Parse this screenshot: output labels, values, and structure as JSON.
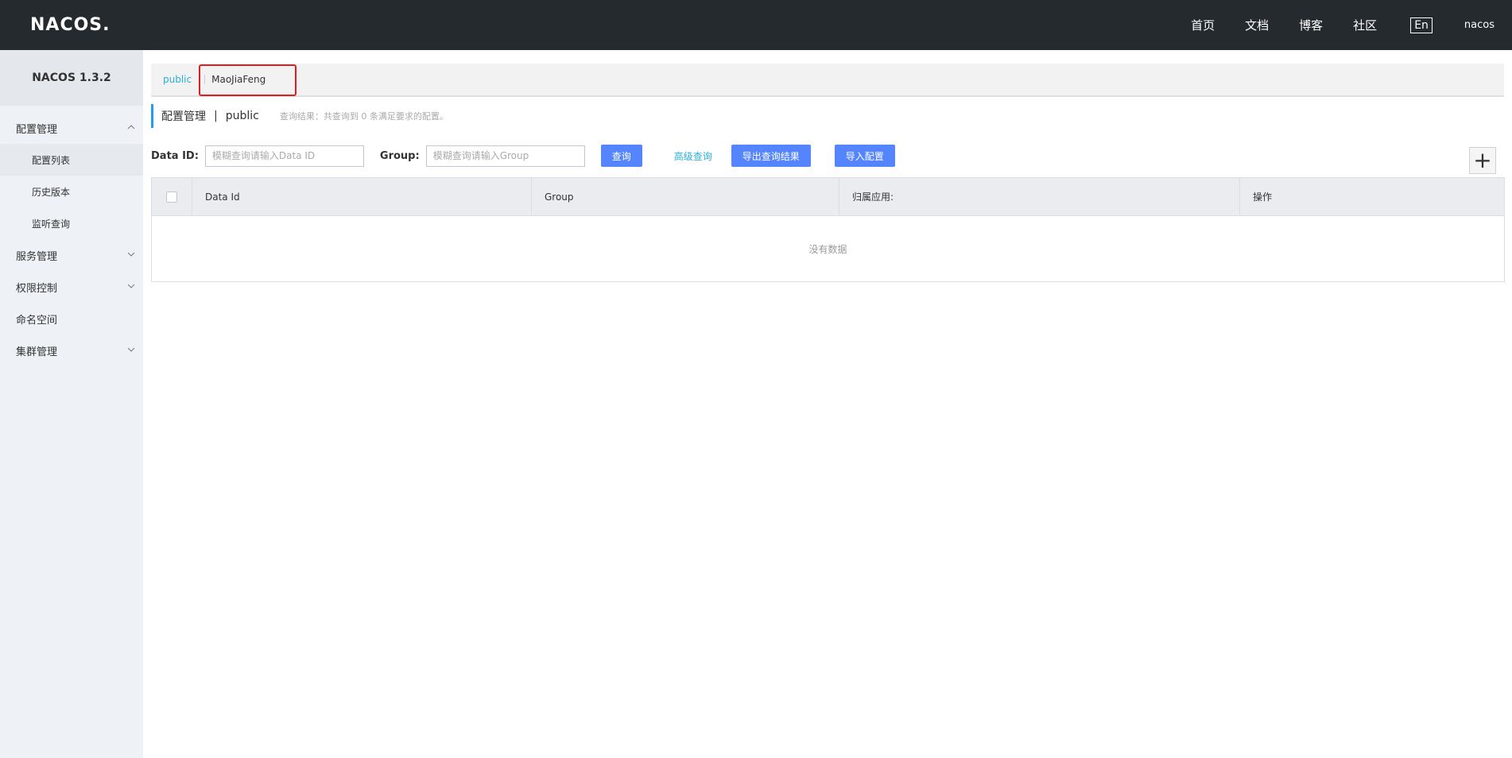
{
  "header": {
    "logo_text": "NACOS.",
    "nav": [
      "首页",
      "文档",
      "博客",
      "社区"
    ],
    "lang": "En",
    "user": "nacos"
  },
  "sidebar": {
    "version": "NACOS 1.3.2",
    "menu": {
      "config_mgmt": "配置管理",
      "config_list": "配置列表",
      "history": "历史版本",
      "listener": "监听查询",
      "service_mgmt": "服务管理",
      "auth": "权限控制",
      "namespace": "命名空间",
      "cluster": "集群管理"
    }
  },
  "namespaces": {
    "public": "public",
    "custom": "MaoJiaFeng"
  },
  "title": {
    "main": "配置管理",
    "divider": "|",
    "ns": "public",
    "result": "查询结果：共查询到 0 条满足要求的配置。"
  },
  "search": {
    "data_id_label": "Data ID:",
    "data_id_placeholder": "模糊查询请输入Data ID",
    "group_label": "Group:",
    "group_placeholder": "模糊查询请输入Group",
    "query_btn": "查询",
    "advanced": "高级查询",
    "export_btn": "导出查询结果",
    "import_btn": "导入配置",
    "add_symbol": "+"
  },
  "table": {
    "columns": [
      "Data Id",
      "Group",
      "归属应用:",
      "操作"
    ],
    "empty": "没有数据"
  },
  "colors": {
    "header_bg": "#252a2f",
    "accent": "#5584ff",
    "link": "#29b0d6",
    "highlight": "#e31d1d"
  }
}
